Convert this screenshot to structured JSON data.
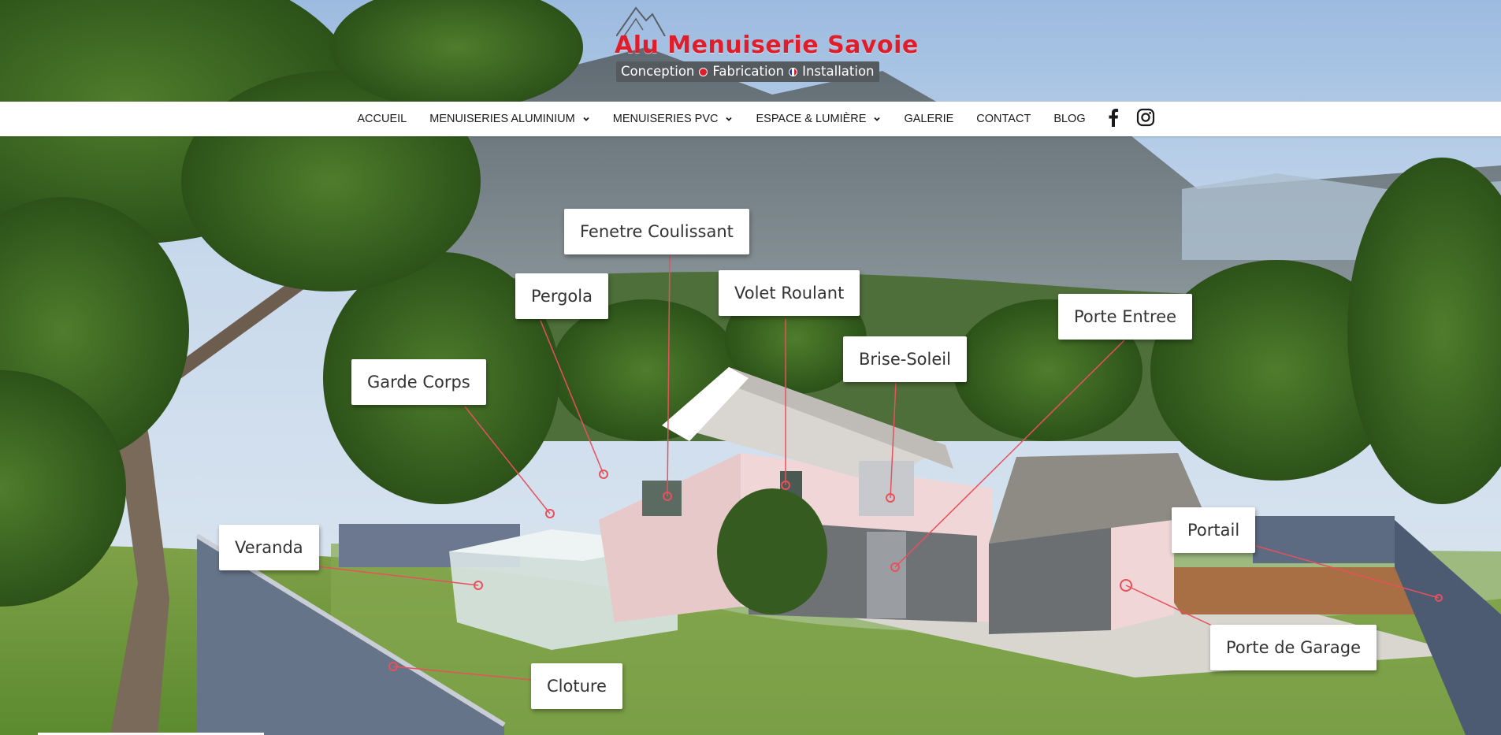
{
  "logo": {
    "brand": "Alu Menuiserie Savoie",
    "tagline_1": "Conception",
    "tagline_2": "Fabrication",
    "tagline_3": "Installation"
  },
  "nav": {
    "items": [
      {
        "label": "ACCUEIL",
        "dropdown": false
      },
      {
        "label": "MENUISERIES ALUMINIUM",
        "dropdown": true
      },
      {
        "label": "MENUISERIES PVC",
        "dropdown": true
      },
      {
        "label": "ESPACE & LUMIÈRE",
        "dropdown": true
      },
      {
        "label": "GALERIE",
        "dropdown": false
      },
      {
        "label": "CONTACT",
        "dropdown": false
      },
      {
        "label": "BLOG",
        "dropdown": false
      }
    ],
    "social": [
      "facebook-icon",
      "instagram-icon"
    ]
  },
  "hotspots": {
    "fenetre_coulissant": "Fenetre Coulissant",
    "pergola": "Pergola",
    "volet_roulant": "Volet Roulant",
    "porte_entree": "Porte Entree",
    "brise_soleil": "Brise-Soleil",
    "garde_corps": "Garde Corps",
    "veranda": "Veranda",
    "portail": "Portail",
    "porte_de_garage": "Porte de Garage",
    "cloture": "Cloture"
  },
  "colors": {
    "brand_red": "#e01d2b",
    "hotspot_line": "#e8505b",
    "nav_bg": "#ffffff"
  }
}
